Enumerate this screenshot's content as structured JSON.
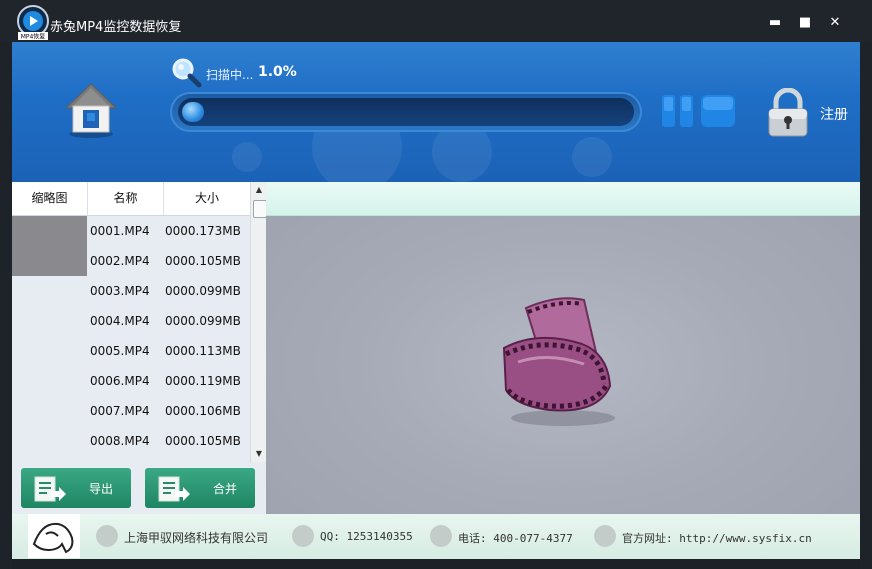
{
  "window": {
    "title": "赤兔MP4监控数据恢复",
    "app_icon_text": "MP4恢复",
    "minimize_glyph": "▬",
    "maximize_glyph": "■",
    "close_glyph": "✕"
  },
  "scan": {
    "status_label": "扫描中...",
    "percent_text": "1.0%",
    "progress_fraction": 0.01
  },
  "header": {
    "register_label": "注册"
  },
  "table": {
    "columns": [
      "缩略图",
      "名称",
      "大小"
    ],
    "rows": [
      {
        "name": "0001.MP4",
        "size": "0000.173MB"
      },
      {
        "name": "0002.MP4",
        "size": "0000.105MB"
      },
      {
        "name": "0003.MP4",
        "size": "0000.099MB"
      },
      {
        "name": "0004.MP4",
        "size": "0000.099MB"
      },
      {
        "name": "0005.MP4",
        "size": "0000.113MB"
      },
      {
        "name": "0006.MP4",
        "size": "0000.119MB"
      },
      {
        "name": "0007.MP4",
        "size": "0000.106MB"
      },
      {
        "name": "0008.MP4",
        "size": "0000.105MB"
      }
    ]
  },
  "actions": {
    "export_label": "导出",
    "merge_label": "合并"
  },
  "footer": {
    "company": "上海甲驭网络科技有限公司",
    "qq": "QQ: 1253140355",
    "phone": "电话: 400-077-4377",
    "website": "官方网址: http://www.sysfix.cn"
  },
  "colors": {
    "header_blue": "#1f6ec6",
    "accent_green": "#2a9673",
    "film_purple": "#9a4f84"
  },
  "icons": {
    "home": "home-icon",
    "search": "magnifier-icon",
    "pause": "pause-icon",
    "stop": "stop-icon",
    "lock": "lock-icon",
    "film": "film-reel-icon"
  }
}
